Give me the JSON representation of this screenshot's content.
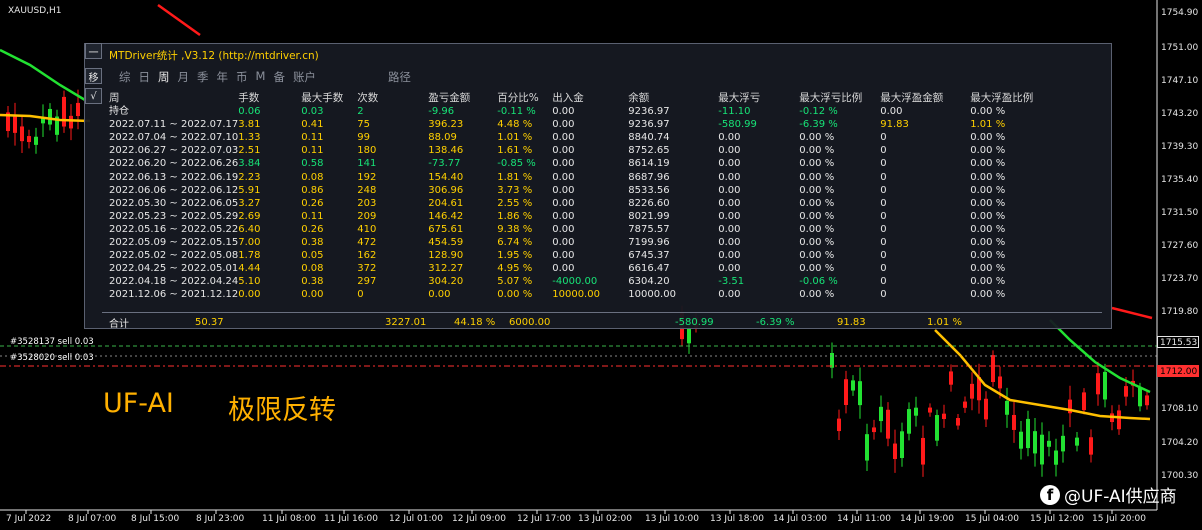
{
  "chart": {
    "symbol": "XAUUSD,H1",
    "colors": {
      "bull": "#22e232",
      "bear": "#ff1a1a",
      "ma_fast": "#22e232",
      "ma_slow": "#ffc000",
      "ma_red": "#ff1a1a"
    },
    "price_labels": [
      "1754.90",
      "1751.00",
      "1747.10",
      "1743.20",
      "1739.30",
      "1735.40",
      "1731.50",
      "1727.60",
      "1723.70",
      "1719.80",
      "1712.00",
      "1708.10",
      "1704.20",
      "1700.30"
    ],
    "price_boxes": [
      {
        "text": "1715.53",
        "color": "#e6e6e6",
        "bg": "#000",
        "border": "#e6e6e6"
      },
      {
        "text": "1712.00",
        "color": "#000",
        "bg": "#ff3030",
        "border": "#ff3030"
      }
    ],
    "time_labels": [
      "7 Jul 2022",
      "8 Jul 07:00",
      "8 Jul 15:00",
      "8 Jul 23:00",
      "11 Jul 08:00",
      "11 Jul 16:00",
      "12 Jul 01:00",
      "12 Jul 09:00",
      "12 Jul 17:00",
      "13 Jul 02:00",
      "13 Jul 10:00",
      "13 Jul 18:00",
      "14 Jul 03:00",
      "14 Jul 11:00",
      "14 Jul 19:00",
      "15 Jul 04:00",
      "15 Jul 12:00",
      "15 Jul 20:00"
    ],
    "orders": [
      "#3528137 sell 0.03",
      "#3528020 sell 0.03"
    ],
    "banner_left": "UF-AI",
    "banner_right": "极限反转",
    "watermark_icon": "facebook-icon",
    "watermark_text": "@UF-AI供应商"
  },
  "panel": {
    "title": "MTDriver统计 ,V3.12 (http://mtdriver.cn)",
    "side_buttons": [
      "一",
      "移",
      "√"
    ],
    "tabs": [
      "综",
      "日",
      "周",
      "月",
      "季",
      "年",
      "币",
      "M",
      "备",
      "账户",
      "路径"
    ],
    "active_tab": "周",
    "headers": [
      "周",
      "手数",
      "最大手数",
      "次数",
      "盈亏金额",
      "百分比%",
      "出入金",
      "余额",
      "最大浮亏",
      "最大浮亏比例",
      "最大浮盈金额",
      "最大浮盈比例"
    ],
    "open_row": {
      "label": "持仓",
      "cells": [
        "0.06",
        "0.03",
        "2",
        "-9.96",
        "-0.11 %",
        "0.00",
        "9236.97",
        "-11.10",
        "-0.12 %",
        "0.00",
        "0.00 %"
      ]
    },
    "rows": [
      {
        "period": "2022.07.11 ~ 2022.07.17",
        "cells": [
          "3.81",
          "0.41",
          "75",
          "396.23",
          "4.48 %",
          "0.00",
          "9236.97",
          "-580.99",
          "-6.39 %",
          "91.83",
          "1.01 %"
        ]
      },
      {
        "period": "2022.07.04 ~ 2022.07.10",
        "cells": [
          "1.33",
          "0.11",
          "99",
          "88.09",
          "1.01 %",
          "0.00",
          "8840.74",
          "0.00",
          "0.00 %",
          "0",
          "0.00 %"
        ]
      },
      {
        "period": "2022.06.27 ~ 2022.07.03",
        "cells": [
          "2.51",
          "0.11",
          "180",
          "138.46",
          "1.61 %",
          "0.00",
          "8752.65",
          "0.00",
          "0.00 %",
          "0",
          "0.00 %"
        ]
      },
      {
        "period": "2022.06.20 ~ 2022.06.26",
        "cells": [
          "3.84",
          "0.58",
          "141",
          "-73.77",
          "-0.85 %",
          "0.00",
          "8614.19",
          "0.00",
          "0.00 %",
          "0",
          "0.00 %"
        ]
      },
      {
        "period": "2022.06.13 ~ 2022.06.19",
        "cells": [
          "2.23",
          "0.08",
          "192",
          "154.40",
          "1.81 %",
          "0.00",
          "8687.96",
          "0.00",
          "0.00 %",
          "0",
          "0.00 %"
        ]
      },
      {
        "period": "2022.06.06 ~ 2022.06.12",
        "cells": [
          "5.91",
          "0.86",
          "248",
          "306.96",
          "3.73 %",
          "0.00",
          "8533.56",
          "0.00",
          "0.00 %",
          "0",
          "0.00 %"
        ]
      },
      {
        "period": "2022.05.30 ~ 2022.06.05",
        "cells": [
          "3.27",
          "0.26",
          "203",
          "204.61",
          "2.55 %",
          "0.00",
          "8226.60",
          "0.00",
          "0.00 %",
          "0",
          "0.00 %"
        ]
      },
      {
        "period": "2022.05.23 ~ 2022.05.29",
        "cells": [
          "2.69",
          "0.11",
          "209",
          "146.42",
          "1.86 %",
          "0.00",
          "8021.99",
          "0.00",
          "0.00 %",
          "0",
          "0.00 %"
        ]
      },
      {
        "period": "2022.05.16 ~ 2022.05.22",
        "cells": [
          "6.40",
          "0.26",
          "410",
          "675.61",
          "9.38 %",
          "0.00",
          "7875.57",
          "0.00",
          "0.00 %",
          "0",
          "0.00 %"
        ]
      },
      {
        "period": "2022.05.09 ~ 2022.05.15",
        "cells": [
          "7.00",
          "0.38",
          "472",
          "454.59",
          "6.74 %",
          "0.00",
          "7199.96",
          "0.00",
          "0.00 %",
          "0",
          "0.00 %"
        ]
      },
      {
        "period": "2022.05.02 ~ 2022.05.08",
        "cells": [
          "1.78",
          "0.05",
          "162",
          "128.90",
          "1.95 %",
          "0.00",
          "6745.37",
          "0.00",
          "0.00 %",
          "0",
          "0.00 %"
        ]
      },
      {
        "period": "2022.04.25 ~ 2022.05.01",
        "cells": [
          "4.44",
          "0.08",
          "372",
          "312.27",
          "4.95 %",
          "0.00",
          "6616.47",
          "0.00",
          "0.00 %",
          "0",
          "0.00 %"
        ]
      },
      {
        "period": "2022.04.18 ~ 2022.04.24",
        "cells": [
          "5.10",
          "0.38",
          "297",
          "304.20",
          "5.07 %",
          "-4000.00",
          "6304.20",
          "-3.51",
          "-0.06 %",
          "0",
          "0.00 %"
        ]
      },
      {
        "period": "2021.12.06 ~ 2021.12.12",
        "cells": [
          "0.00",
          "0.00",
          "0",
          "0.00",
          "0.00 %",
          "10000.00",
          "10000.00",
          "0.00",
          "0.00 %",
          "0",
          "0.00 %"
        ]
      }
    ],
    "summary": {
      "label": "合计",
      "cells": [
        "50.37",
        "",
        "",
        "3227.01",
        "44.18 %",
        "6000.00",
        "",
        "-580.99",
        "-6.39 %",
        "91.83",
        "1.01 %"
      ]
    }
  }
}
